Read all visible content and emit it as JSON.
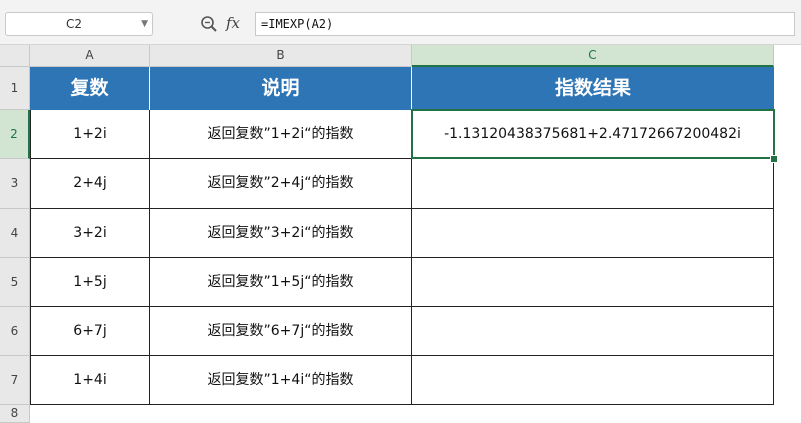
{
  "name_box": {
    "value": "C2"
  },
  "formula_bar": {
    "zoom_icon": "zoom-icon",
    "fx_label": "fx",
    "formula": "=IMEXP(A2)"
  },
  "columns": [
    "A",
    "B",
    "C"
  ],
  "rows": [
    "1",
    "2",
    "3",
    "4",
    "5",
    "6",
    "7",
    "8"
  ],
  "selected_cell": "C2",
  "table": {
    "headers": [
      "复数",
      "说明",
      "指数结果"
    ],
    "rows": [
      {
        "a": "1+2i",
        "b": "返回复数”1+2i“的指数",
        "c": "-1.13120438375681+2.47172667200482i"
      },
      {
        "a": "2+4j",
        "b": "返回复数”2+4j“的指数",
        "c": ""
      },
      {
        "a": "3+2i",
        "b": "返回复数”3+2i“的指数",
        "c": ""
      },
      {
        "a": "1+5j",
        "b": "返回复数”1+5j“的指数",
        "c": ""
      },
      {
        "a": "6+7j",
        "b": "返回复数”6+7j“的指数",
        "c": ""
      },
      {
        "a": "1+4i",
        "b": "返回复数”1+4i“的指数",
        "c": ""
      }
    ]
  },
  "colors": {
    "header_fill": "#2e75b6",
    "header_text": "#ffffff",
    "selection": "#217346"
  }
}
